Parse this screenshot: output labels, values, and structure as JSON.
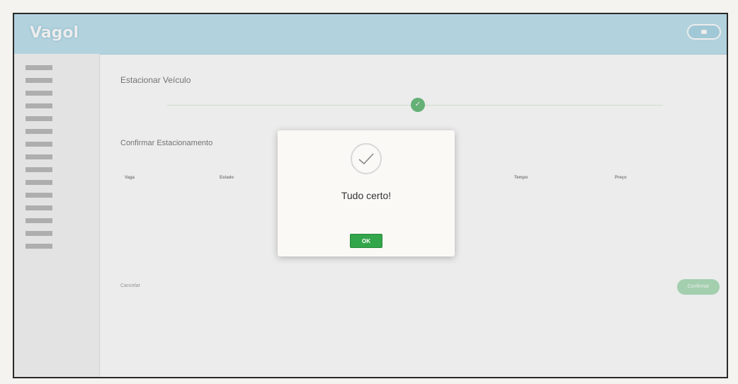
{
  "header": {
    "brand": "Vagol",
    "user_line1": "",
    "user_line2": ""
  },
  "sidebar": {
    "items": [
      {
        "label": ""
      },
      {
        "label": ""
      },
      {
        "label": ""
      },
      {
        "label": ""
      },
      {
        "label": ""
      },
      {
        "label": ""
      },
      {
        "label": ""
      },
      {
        "label": ""
      },
      {
        "label": ""
      },
      {
        "label": ""
      },
      {
        "label": ""
      },
      {
        "label": ""
      },
      {
        "label": ""
      },
      {
        "label": ""
      },
      {
        "label": ""
      }
    ]
  },
  "main": {
    "page_title": "Estacionar Veículo",
    "steps": [
      {
        "label": ""
      },
      {
        "label": ""
      },
      {
        "label": ""
      }
    ],
    "section_title": "Confirmar Estacionamento",
    "reservation_date": "",
    "table": {
      "headers": [
        "Vaga",
        "Estado",
        "Tempo",
        "Preço"
      ],
      "row": [
        "",
        "",
        "",
        ""
      ]
    },
    "totals": {
      "balance": "",
      "total": "",
      "after": ""
    },
    "cancel_label": "Cancelar",
    "confirm_label": "Confirmar"
  },
  "modal": {
    "title": "Tudo certo!",
    "subtitle": "",
    "ok_label": "OK"
  },
  "colors": {
    "topbar": "#a7d8ea",
    "success": "#33a54a",
    "confirm": "#8fd3a1"
  }
}
